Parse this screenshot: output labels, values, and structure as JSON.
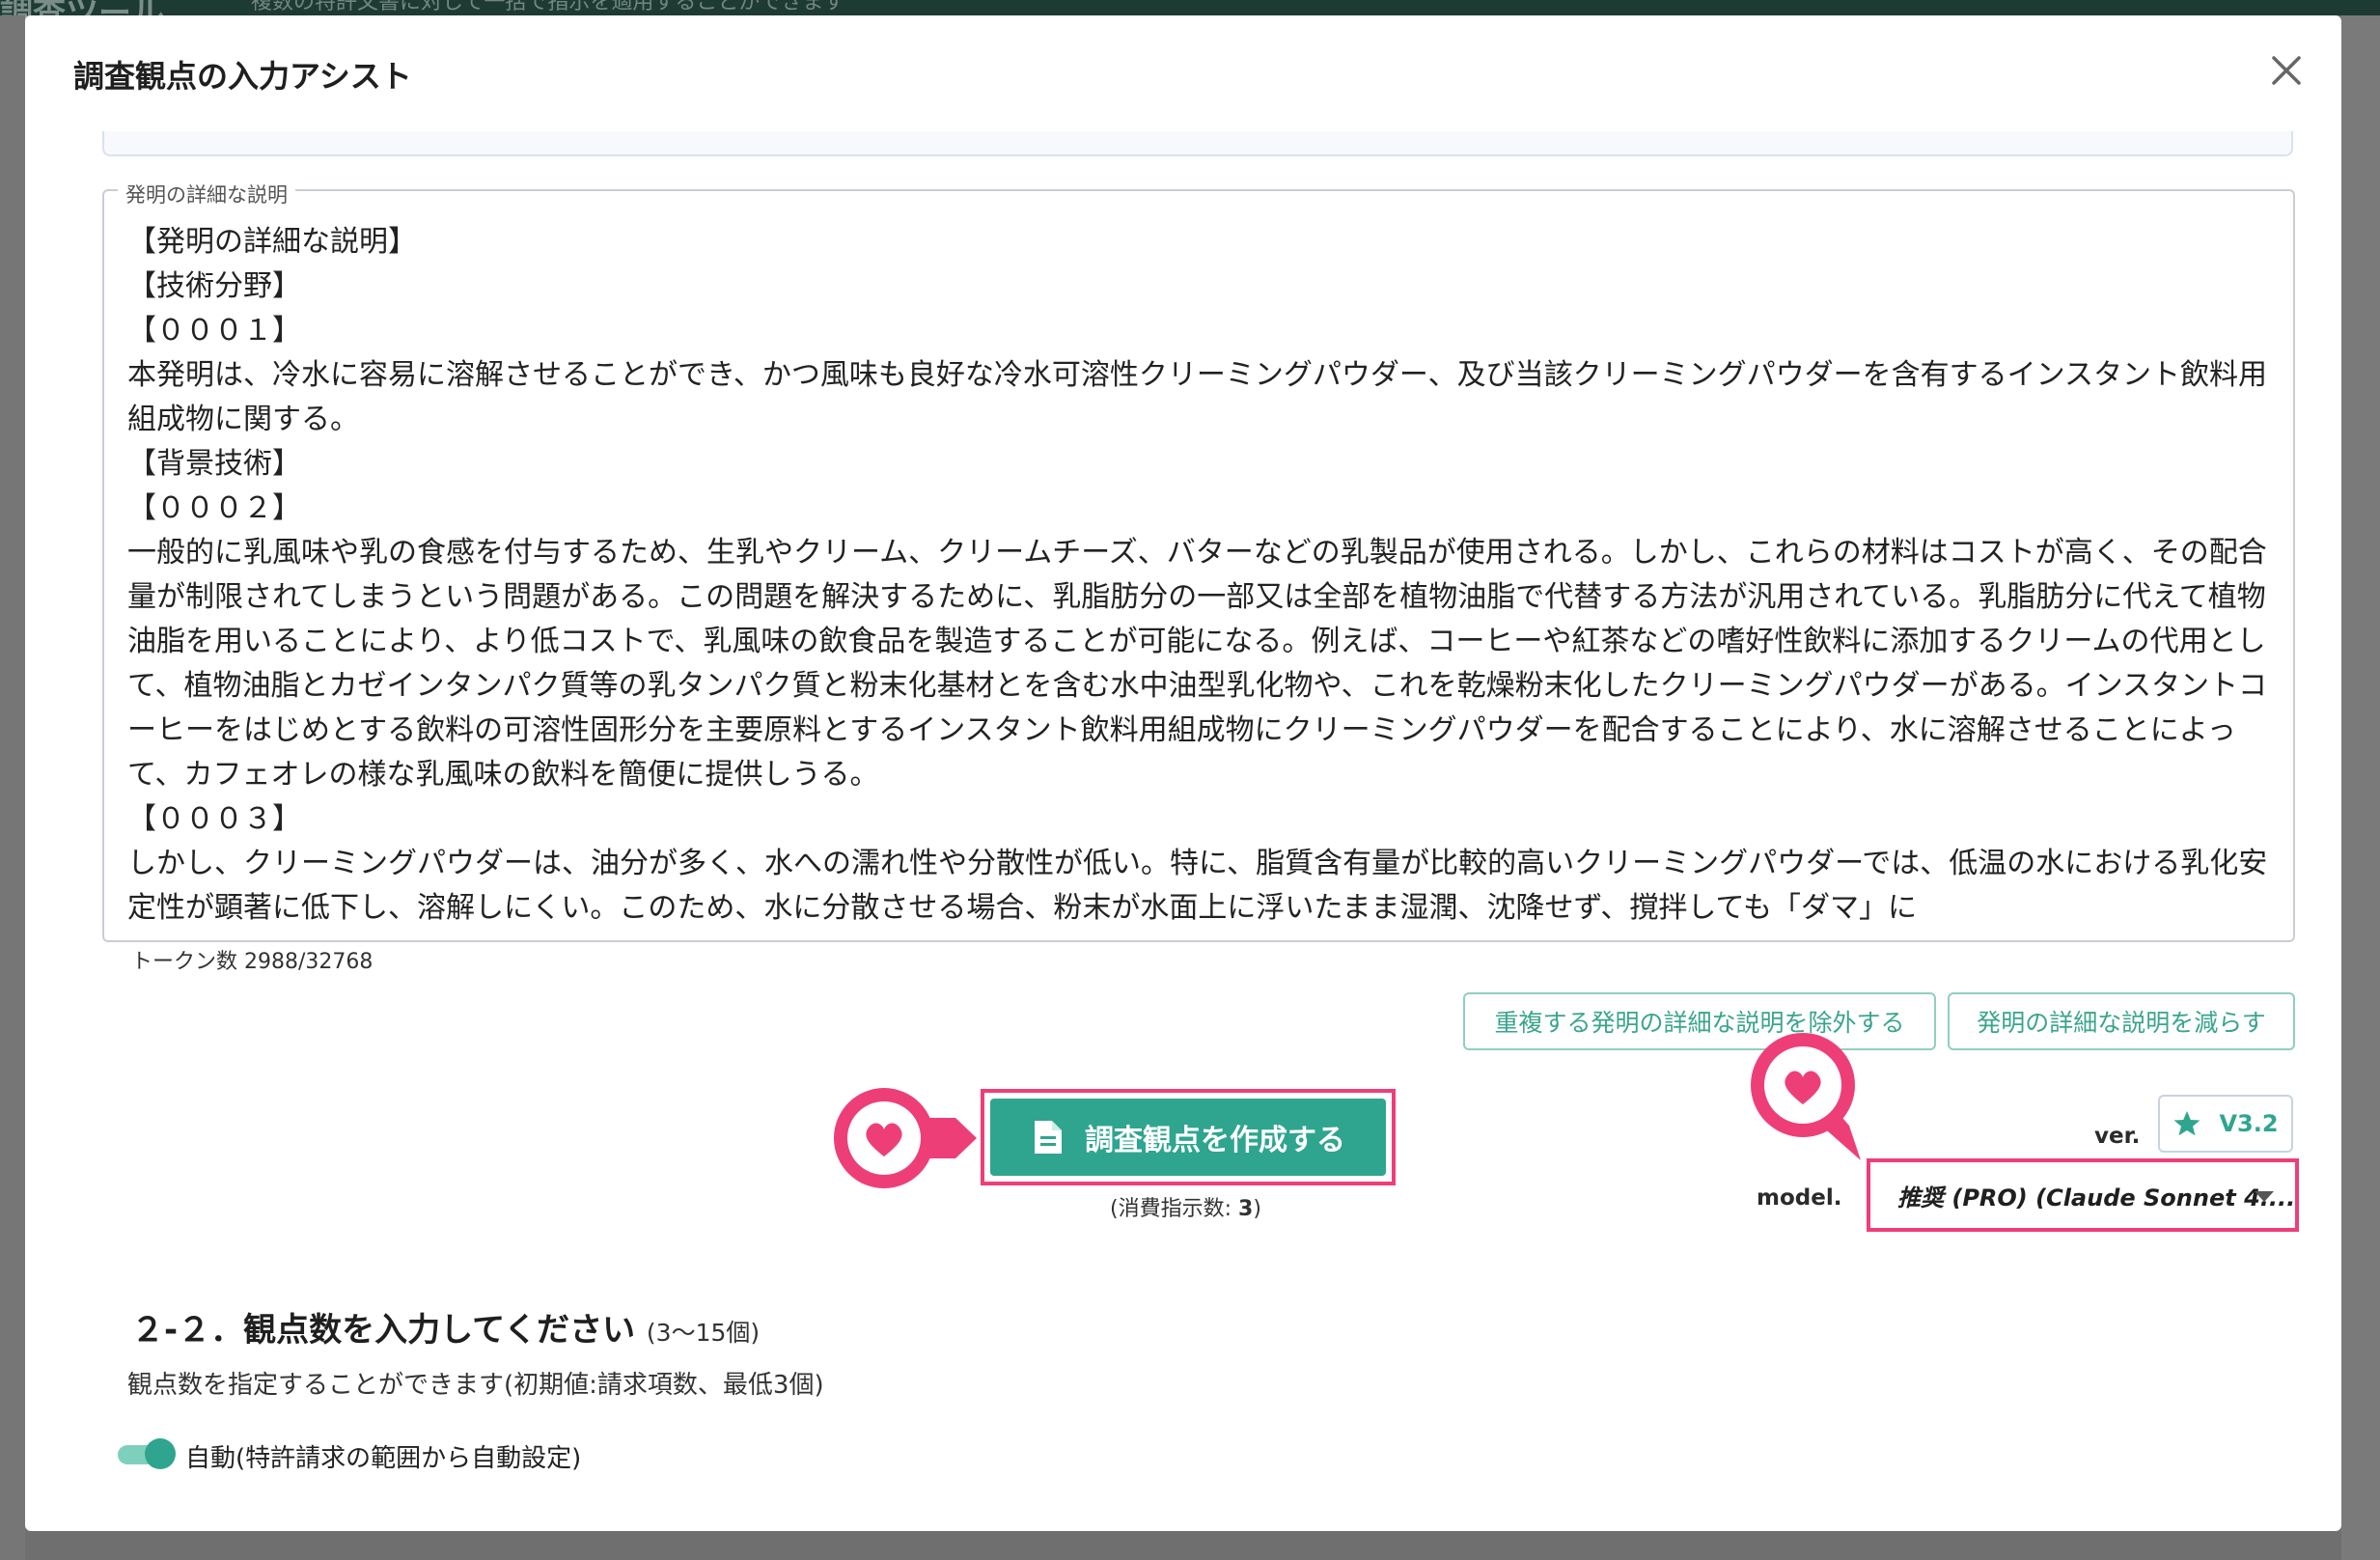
{
  "background": {
    "title_fragment": "調査ツール",
    "note_fragment": "複数の特許文書に対して一括で指示を適用することができます"
  },
  "modal": {
    "title": "調査観点の入力アシスト",
    "close_icon": "close-icon"
  },
  "description": {
    "legend": "発明の詳細な説明",
    "lines": [
      "【発明の詳細な説明】",
      "【技術分野】",
      "【０００１】",
      "本発明は、冷水に容易に溶解させることができ、かつ風味も良好な冷水可溶性クリーミングパウダー、及び当該クリーミングパウダーを含有するインスタント飲料用組成物に関する。",
      "【背景技術】",
      "【０００２】",
      "一般的に乳風味や乳の食感を付与するため、生乳やクリーム、クリームチーズ、バターなどの乳製品が使用される。しかし、これらの材料はコストが高く、その配合量が制限されてしまうという問題がある。この問題を解決するために、乳脂肪分の一部又は全部を植物油脂で代替する方法が汎用されている。乳脂肪分に代えて植物油脂を用いることにより、より低コストで、乳風味の飲食品を製造することが可能になる。例えば、コーヒーや紅茶などの嗜好性飲料に添加するクリームの代用として、植物油脂とカゼインタンパク質等の乳タンパク質と粉末化基材とを含む水中油型乳化物や、これを乾燥粉末化したクリーミングパウダーがある。インスタントコーヒーをはじめとする飲料の可溶性固形分を主要原料とするインスタント飲料用組成物にクリーミングパウダーを配合することにより、水に溶解させることによって、カフェオレの様な乳風味の飲料を簡便に提供しうる。",
      "【０００３】",
      "しかし、クリーミングパウダーは、油分が多く、水への濡れ性や分散性が低い。特に、脂質含有量が比較的高いクリーミングパウダーでは、低温の水における乳化安定性が顕著に低下し、溶解しにくい。このため、水に分散させる場合、粉末が水面上に浮いたまま湿潤、沈降せず、撹拌しても「ダマ」に"
    ]
  },
  "token_count": "トークン数 2988/32768",
  "buttons": {
    "remove_duplicates": "重複する発明の詳細な説明を除外する",
    "reduce": "発明の詳細な説明を減らす",
    "create": "調査観点を作成する",
    "create_icon": "document-icon"
  },
  "consume": {
    "prefix": "(消費指示数: ",
    "count": "3",
    "suffix": ")"
  },
  "version": {
    "label": "ver.",
    "value": "V3.2",
    "icon": "star-icon"
  },
  "model": {
    "label": "model.",
    "selected": "推奨 (PRO) (Claude Sonnet 4...."
  },
  "section": {
    "title": "２-２．観点数を入力してください",
    "range": "(3〜15個)",
    "description": "観点数を指定することができます(初期値:請求項数、最低3個)",
    "toggle_label": "自動(特許請求の範囲から自動設定)",
    "toggle_on": true
  },
  "colors": {
    "accent": "#2fa58f",
    "highlight": "#ee3e78",
    "outline": "#8fcfc0"
  }
}
